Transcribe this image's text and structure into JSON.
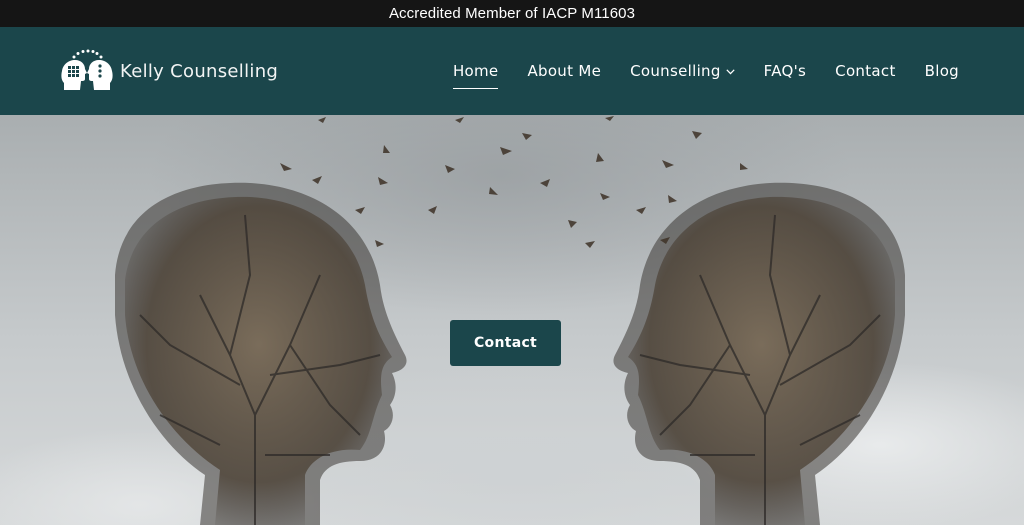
{
  "topbar": {
    "text": "Accredited Member of IACP M11603"
  },
  "header": {
    "logo_text": "Kelly Counselling",
    "nav": [
      {
        "label": "Home",
        "active": true
      },
      {
        "label": "About Me"
      },
      {
        "label": "Counselling",
        "has_dropdown": true
      },
      {
        "label": "FAQ's"
      },
      {
        "label": "Contact"
      },
      {
        "label": "Blog"
      }
    ]
  },
  "hero": {
    "button_label": "Contact"
  },
  "colors": {
    "topbar_bg": "#151515",
    "nav_bg": "#1b464b",
    "button_bg": "#1b464b"
  }
}
